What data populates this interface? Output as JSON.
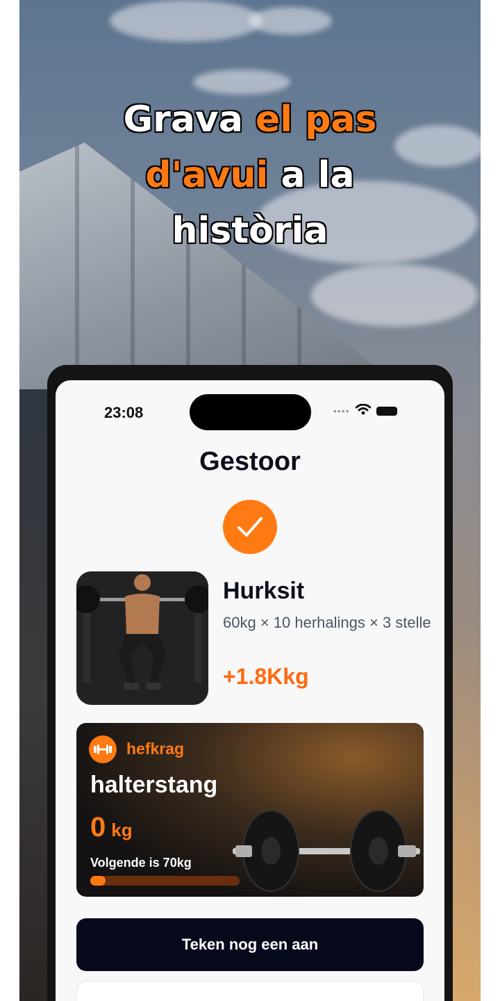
{
  "headline": {
    "part1": "Grava ",
    "highlight1": "el pas",
    "highlight2": "d'avui",
    "part2": " a la",
    "part3": "història"
  },
  "status_bar": {
    "time": "23:08",
    "icons": [
      "signal-dots-icon",
      "wifi-icon",
      "battery-icon"
    ]
  },
  "screen": {
    "title": "Gestoor",
    "check_icon": "checkmark-icon",
    "exercise": {
      "name": "Hurksit",
      "details": "60kg × 10 herhalings × 3 stelle",
      "gain": "+1.8Kkg"
    },
    "strength_card": {
      "tag": "hefkrag",
      "equipment": "halterstang",
      "weight_value": "0",
      "weight_unit": "kg",
      "next_label": "Volgende is 70kg",
      "progress": 0.1
    },
    "primary_button": "Teken nog een aan",
    "secondary_button": ""
  },
  "colors": {
    "accent": "#ff7a12",
    "dark_button": "#060a1c",
    "title": "#0d0f1c"
  }
}
